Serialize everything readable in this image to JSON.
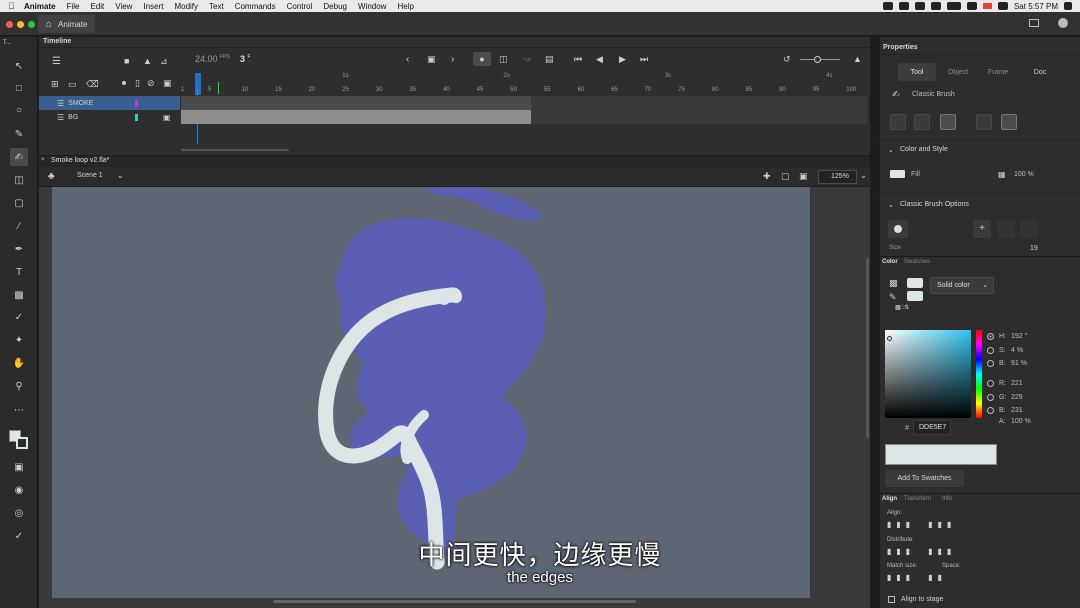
{
  "menubar": {
    "app": "Animate",
    "items": [
      "File",
      "Edit",
      "View",
      "Insert",
      "Modify",
      "Text",
      "Commands",
      "Control",
      "Debug",
      "Window",
      "Help"
    ],
    "clock": "Sat 5:57 PM"
  },
  "titlebar": {
    "tab": "Animate"
  },
  "toolbar": {
    "label": "T..."
  },
  "timeline": {
    "title": "Timeline",
    "fps": "24.00",
    "fps_unit": "FPS",
    "current_frame": "3",
    "frame_unit": "F",
    "layers": [
      {
        "name": "SMOKE",
        "color": "#b43cd8",
        "selected": true
      },
      {
        "name": "BG",
        "color": "#2bd1c9",
        "selected": false
      }
    ],
    "ruler": [
      "1",
      "5",
      "10",
      "15",
      "20",
      "25",
      "30",
      "35",
      "40",
      "45",
      "50",
      "55",
      "60",
      "65",
      "70",
      "75",
      "80",
      "85",
      "90",
      "95",
      "100"
    ],
    "seconds": [
      "1s",
      "2s",
      "3s",
      "4s"
    ]
  },
  "document": {
    "tab": "Smoke loop v2.fla*",
    "scene": "Scene 1",
    "zoom": "125%"
  },
  "properties": {
    "title": "Properties",
    "tabs": [
      "Tool",
      "Object",
      "Frame",
      "Doc"
    ],
    "tool_name": "Classic Brush",
    "color_style": {
      "heading": "Color and Style",
      "fill_label": "Fill",
      "fill_alpha": "100 %",
      "fill_color": "#dde5e7"
    },
    "brush_options": {
      "heading": "Classic Brush Options",
      "size_label": "Size",
      "size_value": "19"
    }
  },
  "color_panel": {
    "tabs": [
      "Color",
      "Swatches"
    ],
    "type": "Solid color",
    "hsb": [
      {
        "label": "H:",
        "value": "192 °"
      },
      {
        "label": "S:",
        "value": "4 %"
      },
      {
        "label": "B:",
        "value": "91 %"
      }
    ],
    "rgb": [
      {
        "label": "R:",
        "value": "221"
      },
      {
        "label": "G:",
        "value": "229"
      },
      {
        "label": "B:",
        "value": "231"
      }
    ],
    "alpha": {
      "label": "A:",
      "value": "100 %"
    },
    "hex": "DDE5E7",
    "hex_prefix": "#",
    "add_swatch": "Add To Swatches"
  },
  "align_panel": {
    "tabs": [
      "Align",
      "Transform",
      "Info"
    ],
    "align_label": "Align:",
    "distribute_label": "Distribute:",
    "match_size_label": "Match size:",
    "space_label": "Space:",
    "align_to_stage": "Align to stage"
  },
  "subtitles": {
    "chinese": "中间更快，边缘更慢",
    "english": "the edges"
  },
  "colors": {
    "stage": "#5f6673",
    "smoke": "#5a5fb4",
    "stroke": "#dde5e7",
    "accent": "#2680eb"
  }
}
